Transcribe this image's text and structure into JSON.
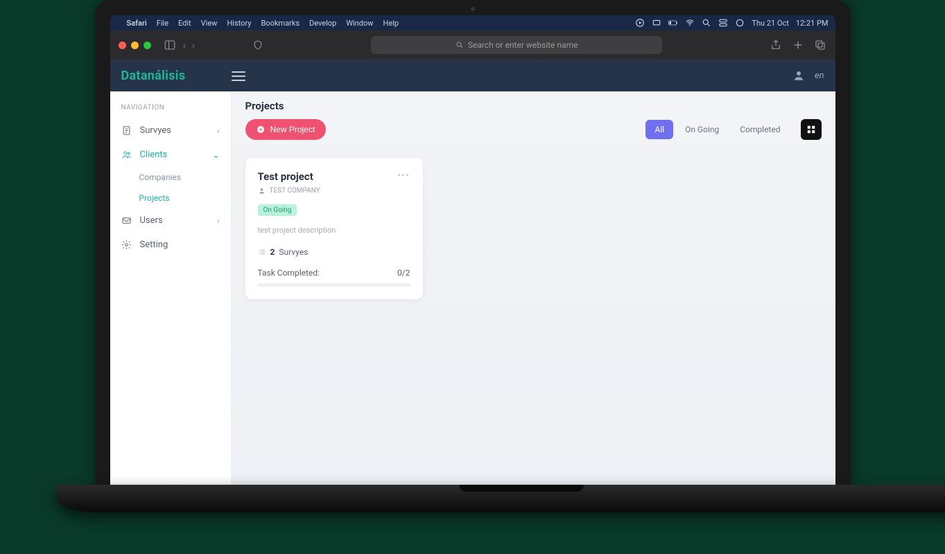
{
  "mac_menubar": {
    "app": "Safari",
    "items": [
      "File",
      "Edit",
      "View",
      "History",
      "Bookmarks",
      "Develop",
      "Window",
      "Help"
    ],
    "date": "Thu 21 Oct",
    "time": "12:21 PM"
  },
  "safari": {
    "placeholder": "Search or enter website name"
  },
  "app_header": {
    "brand": "Datanálisis",
    "language": "en"
  },
  "sidebar": {
    "heading": "NAVIGATION",
    "items": [
      {
        "label": "Survyes",
        "expandable": true,
        "active": false
      },
      {
        "label": "Clients",
        "expandable": true,
        "active": true,
        "children": [
          {
            "label": "Companies",
            "active": false
          },
          {
            "label": "Projects",
            "active": true
          }
        ]
      },
      {
        "label": "Users",
        "expandable": true,
        "active": false
      },
      {
        "label": "Setting",
        "expandable": false,
        "active": false
      }
    ]
  },
  "page": {
    "title": "Projects",
    "new_button": "New Project",
    "filters": [
      "All",
      "On Going",
      "Completed"
    ],
    "active_filter": "All"
  },
  "project_card": {
    "title": "Test project",
    "company": "TEST COMPANY",
    "status": "On Going",
    "description": "test project description",
    "survey_count": "2",
    "survey_label": "Survyes",
    "task_label": "Task Completed:",
    "task_value": "0/2",
    "progress_percent": 0
  }
}
